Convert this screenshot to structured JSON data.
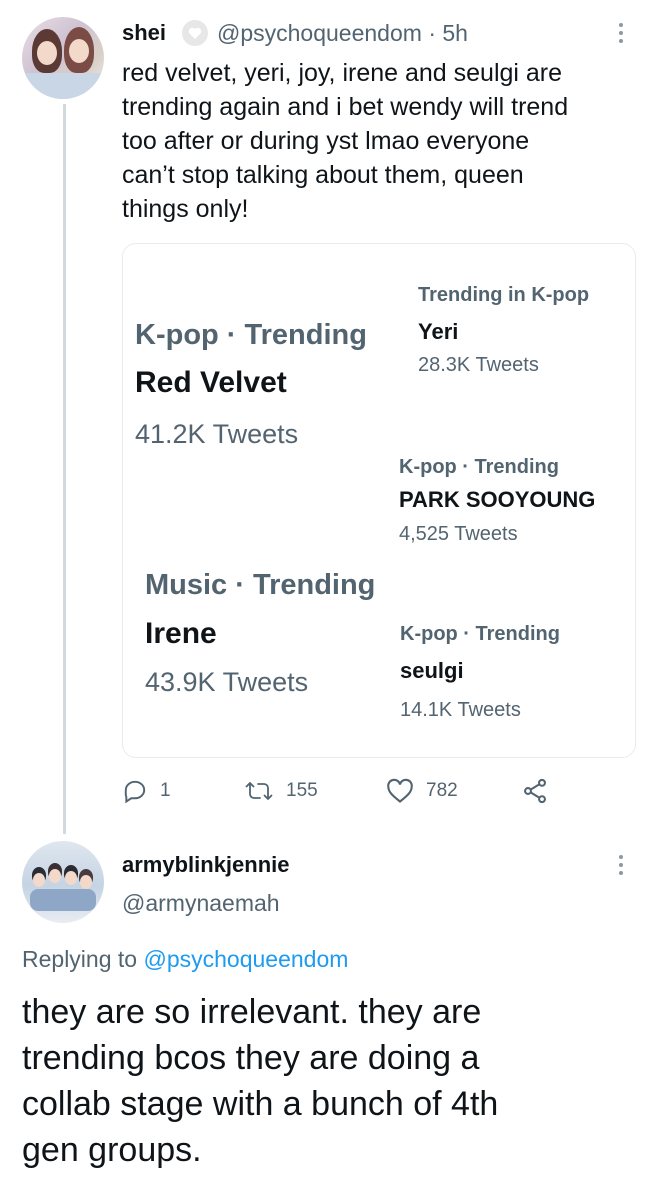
{
  "tweet1": {
    "display_name": "shei",
    "handle": "@psychoqueendom",
    "time": "5h",
    "text_lines": [
      "red velvet, yeri, joy, irene and seulgi are",
      "trending again and i bet wendy will trend",
      "too after or during yst lmao everyone",
      "can’t stop talking about them, queen",
      "things only!"
    ],
    "trends": {
      "red_velvet": {
        "label": "K-pop · Trending",
        "title": "Red Velvet",
        "count": "41.2K Tweets"
      },
      "yeri": {
        "label": "Trending in K-pop",
        "title": "Yeri",
        "count": "28.3K Tweets"
      },
      "park_sooyoung": {
        "label": "K-pop · Trending",
        "title": "PARK SOOYOUNG",
        "count": "4,525 Tweets"
      },
      "irene": {
        "label": "Music · Trending",
        "title": "Irene",
        "count": "43.9K Tweets"
      },
      "seulgi": {
        "label": "K-pop · Trending",
        "title": "seulgi",
        "count": "14.1K Tweets"
      }
    },
    "actions": {
      "replies": "1",
      "retweets": "155",
      "likes": "782"
    }
  },
  "tweet2": {
    "display_name": "armyblinkjennie",
    "handle": "@armynaemah",
    "replying_prefix": "Replying to",
    "replying_handle": "@psychoqueendom",
    "text_lines": [
      "they are so irrelevant. they are",
      "trending bcos they are doing a",
      "collab stage with a bunch of 4th",
      "gen groups."
    ]
  },
  "icons": {
    "heart_badge": "heart-icon",
    "reply": "comment-icon",
    "retweet": "retweet-icon",
    "like": "heart-icon",
    "share": "share-icon",
    "more": "more-vertical-icon"
  },
  "colors": {
    "link": "#1d9bf0",
    "secondary_text": "#536471",
    "thread_line": "#cfd9de"
  }
}
